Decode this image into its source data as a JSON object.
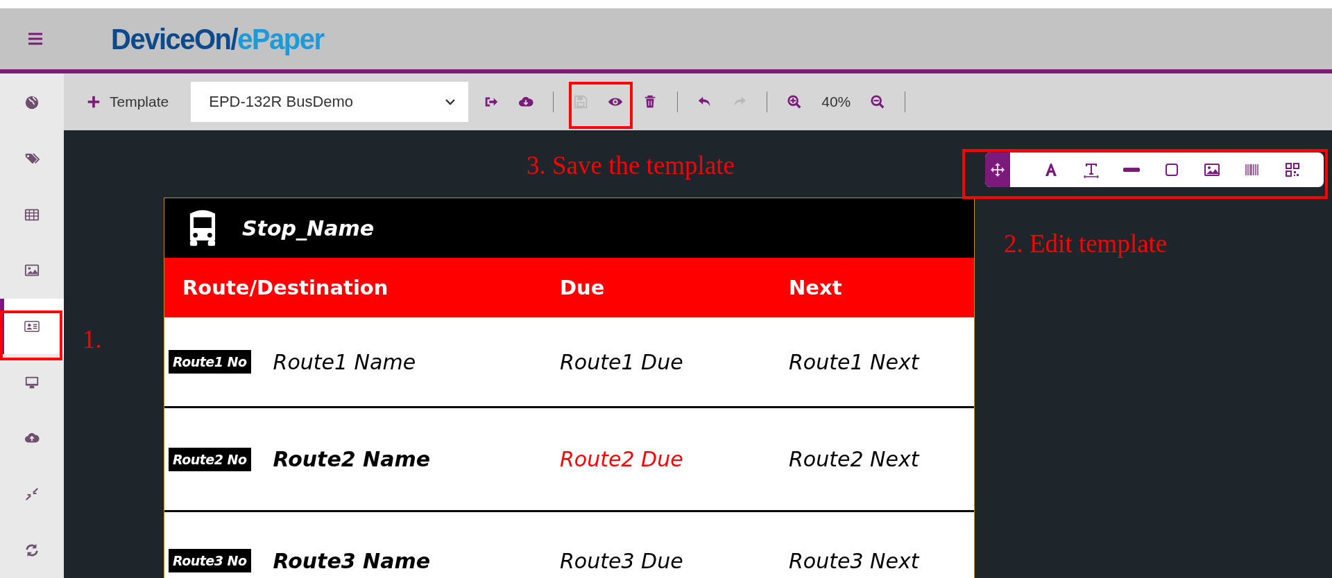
{
  "header": {
    "logo_main": "DeviceOn/",
    "logo_accent": "ePaper"
  },
  "sidebar": {
    "items": [
      {
        "kind": "globe",
        "selected": false
      },
      {
        "kind": "tags",
        "selected": false
      },
      {
        "kind": "table",
        "selected": false
      },
      {
        "kind": "image",
        "selected": false
      },
      {
        "kind": "card",
        "selected": true
      },
      {
        "kind": "monitor",
        "selected": false
      },
      {
        "kind": "upload",
        "selected": false
      },
      {
        "kind": "compress",
        "selected": false
      },
      {
        "kind": "sync",
        "selected": false
      }
    ]
  },
  "toolbar": {
    "add_label": "Template",
    "template": "EPD-132R BusDemo",
    "zoom": "40%",
    "actions": [
      {
        "kind": "export",
        "disabled": false
      },
      {
        "kind": "download",
        "disabled": false
      },
      {
        "kind": "sep"
      },
      {
        "kind": "save",
        "disabled": true
      },
      {
        "kind": "eye",
        "disabled": false
      },
      {
        "kind": "trash",
        "disabled": false
      },
      {
        "kind": "sep"
      },
      {
        "kind": "undo",
        "disabled": false
      },
      {
        "kind": "redo",
        "disabled": true
      },
      {
        "kind": "sep"
      },
      {
        "kind": "zoomin",
        "disabled": false
      },
      {
        "kind": "zoomlabel"
      },
      {
        "kind": "zoomout",
        "disabled": false
      },
      {
        "kind": "sep"
      }
    ]
  },
  "tools": [
    {
      "kind": "move",
      "selected": true
    },
    {
      "kind": "text",
      "selected": false
    },
    {
      "kind": "textbox",
      "selected": false
    },
    {
      "kind": "line",
      "selected": false
    },
    {
      "kind": "rect",
      "selected": false
    },
    {
      "kind": "image",
      "selected": false
    },
    {
      "kind": "barcode",
      "selected": false
    },
    {
      "kind": "qr",
      "selected": false
    }
  ],
  "card": {
    "stop_name": "Stop_Name",
    "columns": [
      "Route/Destination",
      "Due",
      "Next"
    ],
    "rows": [
      {
        "number": "Route1 No",
        "name": "Route1 Name",
        "name_bold": false,
        "due": "Route1 Due",
        "due_alert": false,
        "next": "Route1 Next"
      },
      {
        "number": "Route2 No",
        "name": "Route2 Name",
        "name_bold": true,
        "due": "Route2 Due",
        "due_alert": true,
        "next": "Route2 Next"
      },
      {
        "number": "Route3 No",
        "name": "Route3 Name",
        "name_bold": true,
        "due": "Route3 Due",
        "due_alert": false,
        "next": "Route3 Next"
      }
    ]
  },
  "annotations": [
    {
      "kind": "sidebar",
      "text": "1."
    },
    {
      "kind": "tools",
      "text": "2. Edit template"
    },
    {
      "kind": "save",
      "text": "3. Save the template"
    }
  ]
}
